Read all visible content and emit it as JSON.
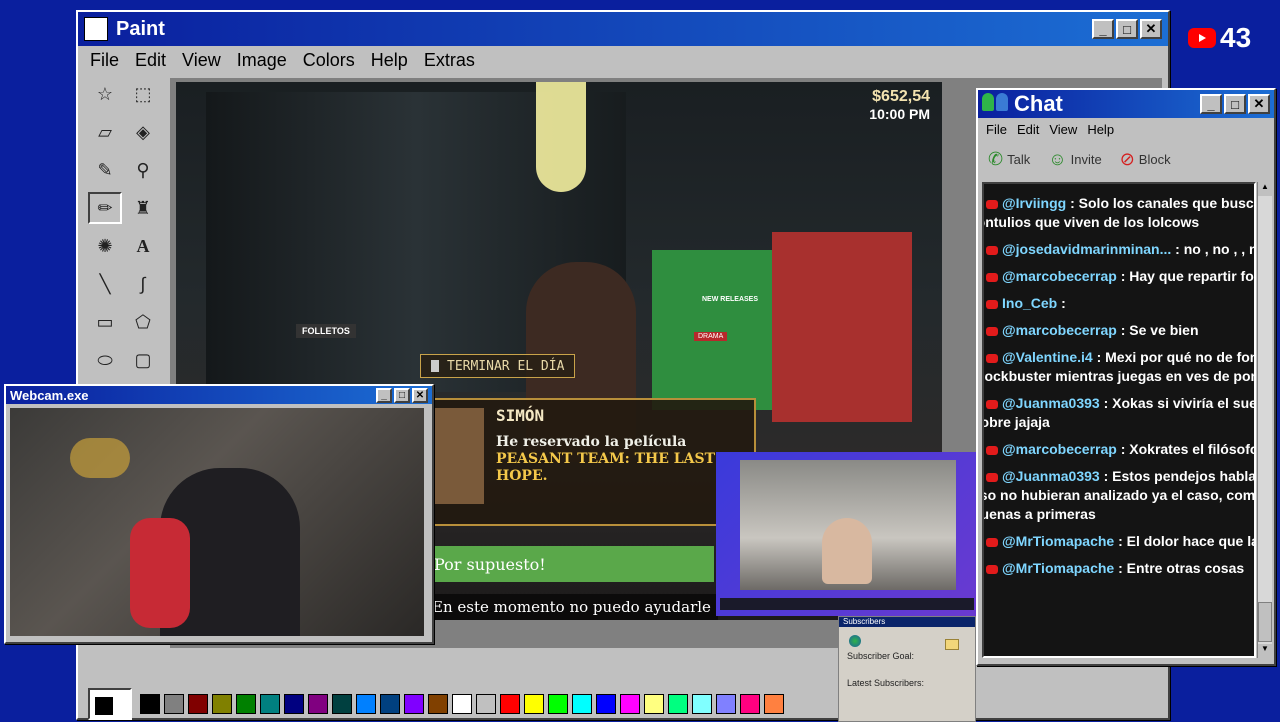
{
  "youtube": {
    "viewer_count": "43"
  },
  "paint": {
    "title": "Paint",
    "menu": [
      "File",
      "Edit",
      "View",
      "Image",
      "Colors",
      "Help",
      "Extras"
    ],
    "palette": [
      "#000000",
      "#808080",
      "#800000",
      "#808000",
      "#008000",
      "#008080",
      "#000080",
      "#800080",
      "#004040",
      "#0080ff",
      "#004080",
      "#8000ff",
      "#804000",
      "#ffffff",
      "#c0c0c0",
      "#ff0000",
      "#ffff00",
      "#00ff00",
      "#00ffff",
      "#0000ff",
      "#ff00ff",
      "#ffff80",
      "#00ff80",
      "#80ffff",
      "#8080ff",
      "#ff0080",
      "#ff8040"
    ]
  },
  "game": {
    "money": "$652,54",
    "time": "10:00 PM",
    "end_day": "TERMINAR EL DÍA",
    "speaker": "SIMÓN",
    "line1": "He reservado la película",
    "movie": "PEASANT TEAM: THE LAST HOPE.",
    "option1": "Por supuesto!",
    "option2": "En este momento no puedo ayudarle",
    "store_sign_left": "FOLLETOS",
    "store_sign_right": "NEW RELEASES",
    "store_sign_rack": "DRAMA"
  },
  "webcam": {
    "title": "Webcam.exe"
  },
  "subscribers": {
    "header": "Subscribers",
    "goal": "Subscriber Goal:",
    "latest": "Latest Subscribers:"
  },
  "chat": {
    "title": "Chat",
    "menu": [
      "File",
      "Edit",
      "View",
      "Help"
    ],
    "toolbar": {
      "talk": "Talk",
      "invite": "Invite",
      "block": "Block"
    },
    "messages": [
      {
        "user": "@Irviingg",
        "text": ": Solo los canales que buscan raso",
        "cont": "tontulios que viven de los lolcows"
      },
      {
        "user": "@josedavidmarinminan...",
        "text": ": no , no , , no. si"
      },
      {
        "user": "@marcobecerrap",
        "text": ": Hay que repartir folletos"
      },
      {
        "user": "Ino_Ceb",
        "text": ":"
      },
      {
        "user": "@marcobecerrap",
        "text": ": Se ve bien"
      },
      {
        "user": "@Valentine.i4",
        "text": ": Mexi por qué no de fondo po",
        "cont": "blockbuster mientras juegas en ves de poner a s"
      },
      {
        "user": "@Juanma0393",
        "text": ": Xokas si viviría el sueño",
        "cont": "pobre jajaja"
      },
      {
        "user": "@marcobecerrap",
        "text": ": Xokrates el filósofo"
      },
      {
        "user": "@Juanma0393",
        "text": ": Estos pendejos hablan co",
        "cont": "eso no hubieran analizado ya el caso, como si n",
        "cont2": "buenas a primeras"
      },
      {
        "user": "@MrTiomapache",
        "text": ": El dolor hace que las pers"
      },
      {
        "user": "@MrTiomapache",
        "text": ": Entre otras cosas"
      }
    ]
  }
}
